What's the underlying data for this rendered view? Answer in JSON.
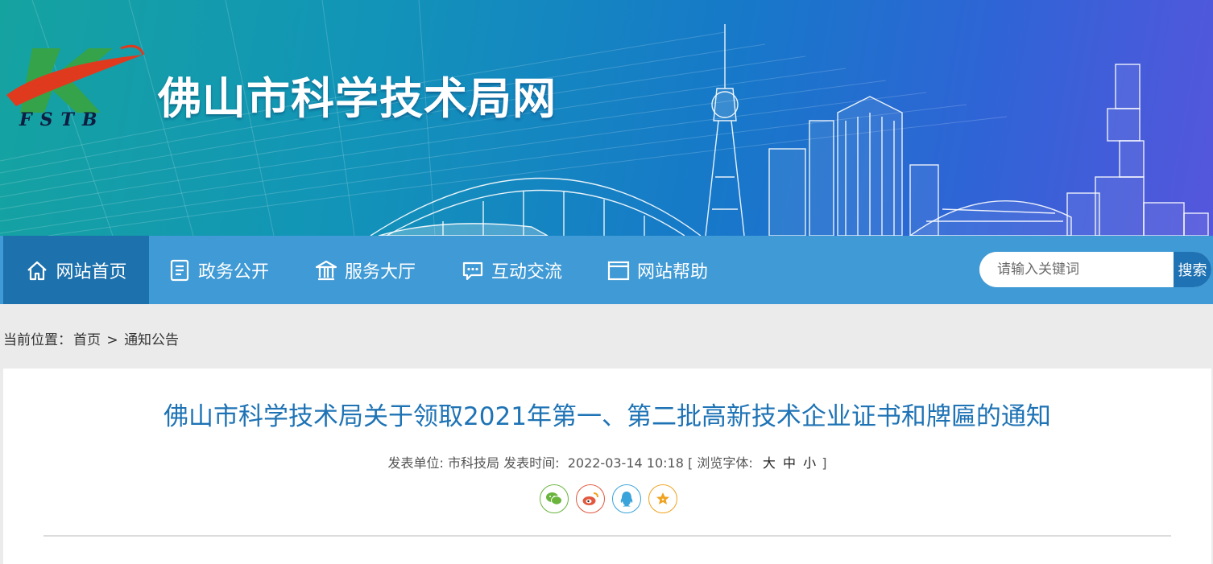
{
  "header": {
    "logo_text": "FSTB",
    "site_title": "佛山市科学技术局网"
  },
  "nav": {
    "items": [
      {
        "label": "网站首页",
        "icon": "home-icon"
      },
      {
        "label": "政务公开",
        "icon": "document-icon"
      },
      {
        "label": "服务大厅",
        "icon": "bank-icon"
      },
      {
        "label": "互动交流",
        "icon": "chat-icon"
      },
      {
        "label": "网站帮助",
        "icon": "window-icon"
      }
    ],
    "active_index": 0
  },
  "search": {
    "placeholder": "请输入关键词",
    "button_label": "搜索"
  },
  "breadcrumb": {
    "prefix": "当前位置：",
    "home": "首页",
    "separator": ">",
    "current": "通知公告"
  },
  "article": {
    "title": "佛山市科学技术局关于领取2021年第一、第二批高新技术企业证书和牌匾的通知",
    "publisher_label": "发表单位:",
    "publisher": "市科技局",
    "time_label": "发表时间:",
    "time": "2022-03-14 10:18",
    "font_label": "[ 浏览字体:",
    "font_sizes": [
      "大",
      "中",
      "小"
    ],
    "font_close": "]",
    "share_icons": [
      {
        "name": "wechat-icon",
        "color": "#6ab43c"
      },
      {
        "name": "weibo-icon",
        "color": "#e2583e"
      },
      {
        "name": "qq-icon",
        "color": "#3aa3d9"
      },
      {
        "name": "favorite-star-icon",
        "color": "#f0a21e"
      }
    ]
  },
  "colors": {
    "nav_bg": "#3f9ad5",
    "nav_active": "#1d71ad",
    "title_blue": "#1e73b5"
  }
}
